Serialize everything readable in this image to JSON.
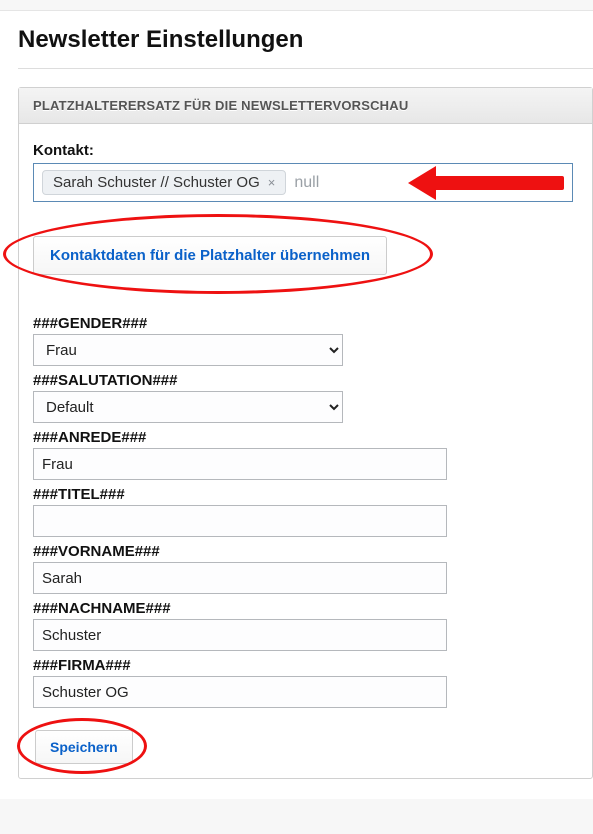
{
  "page": {
    "title": "Newsletter Einstellungen"
  },
  "panel": {
    "heading": "PLATZHALTERERSATZ FÜR DIE NEWSLETTERVORSCHAU"
  },
  "contact": {
    "label": "Kontakt:",
    "chip": "Sarah Schuster // Schuster OG",
    "placeholder": "null"
  },
  "apply_btn": "Kontaktdaten für die Platzhalter übernehmen",
  "fields": {
    "gender": {
      "label": "###GENDER###",
      "value": "Frau"
    },
    "salutation": {
      "label": "###SALUTATION###",
      "value": "Default"
    },
    "anrede": {
      "label": "###ANREDE###",
      "value": "Frau"
    },
    "titel": {
      "label": "###TITEL###",
      "value": ""
    },
    "vorname": {
      "label": "###VORNAME###",
      "value": "Sarah"
    },
    "nachname": {
      "label": "###NACHNAME###",
      "value": "Schuster"
    },
    "firma": {
      "label": "###FIRMA###",
      "value": "Schuster OG"
    }
  },
  "save_btn": "Speichern"
}
